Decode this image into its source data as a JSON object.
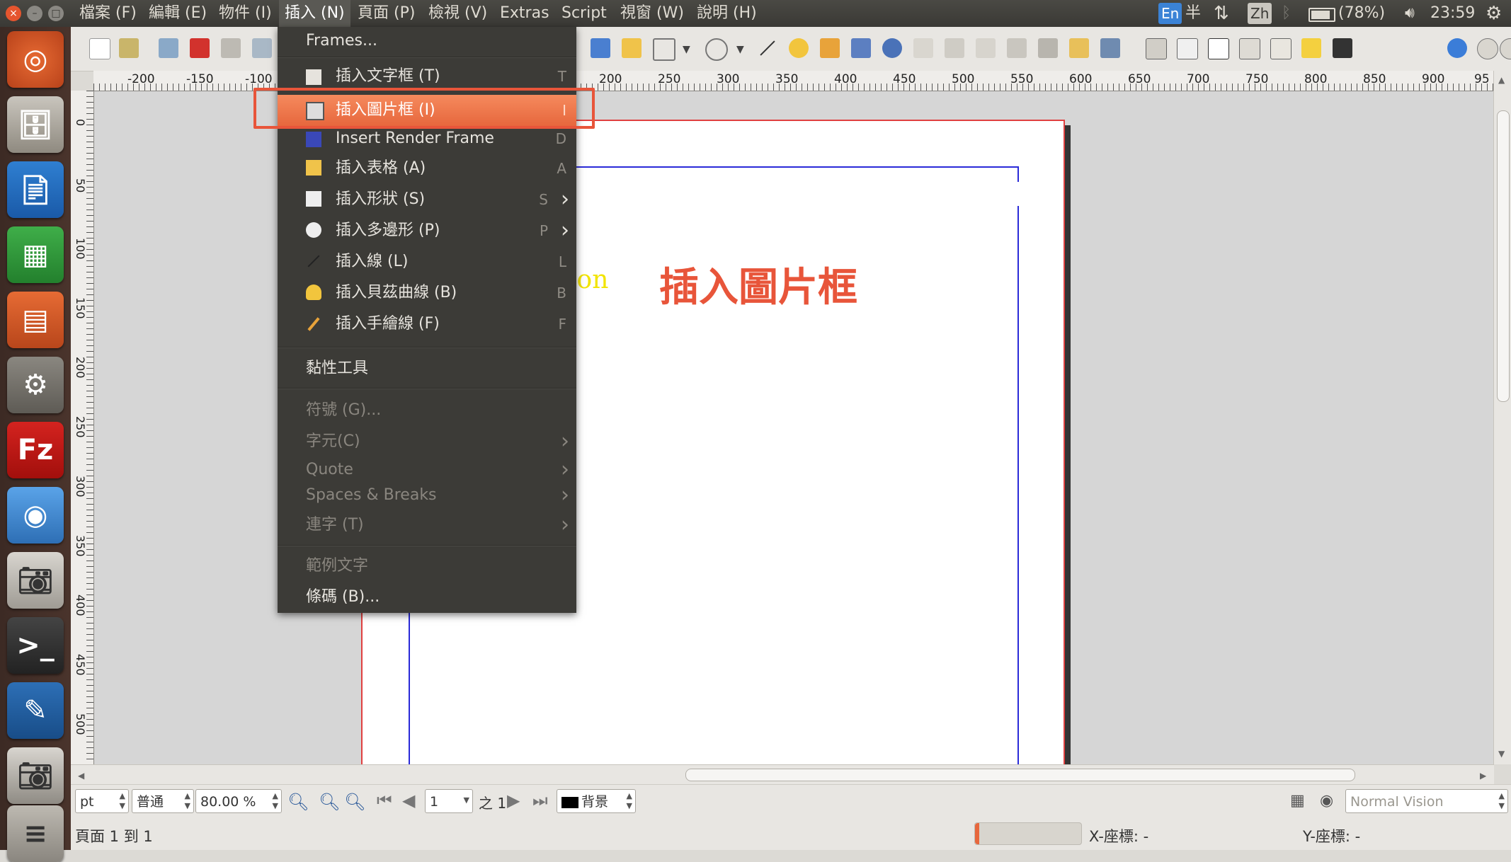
{
  "menubar": {
    "items": [
      "檔案 (F)",
      "編輯 (E)",
      "物件 (I)",
      "插入 (N)",
      "頁面 (P)",
      "檢視 (V)",
      "Extras",
      "Script",
      "視窗 (W)",
      "說明 (H)"
    ],
    "active_index": 3
  },
  "tray": {
    "input_en": "En",
    "half": "半",
    "input_zh": "Zh",
    "battery": "(78%)",
    "time": "23:59"
  },
  "insert_menu": {
    "frames": "Frames...",
    "items": [
      {
        "label": "插入文字框 (T)",
        "shortcut": "T",
        "icon": "text-frame-icon"
      },
      {
        "label": "插入圖片框 (I)",
        "shortcut": "I",
        "icon": "image-frame-icon"
      },
      {
        "label": "Insert Render Frame",
        "shortcut": "D",
        "icon": "render-frame-icon"
      },
      {
        "label": "插入表格 (A)",
        "shortcut": "A",
        "icon": "table-icon"
      },
      {
        "label": "插入形狀 (S)",
        "shortcut": "S",
        "icon": "shape-icon"
      },
      {
        "label": "插入多邊形 (P)",
        "shortcut": "P",
        "icon": "polygon-icon"
      },
      {
        "label": "插入線 (L)",
        "shortcut": "L",
        "icon": "line-icon"
      },
      {
        "label": "插入貝茲曲線 (B)",
        "shortcut": "B",
        "icon": "bezier-icon"
      },
      {
        "label": "插入手繪線 (F)",
        "shortcut": "F",
        "icon": "freehand-icon"
      }
    ],
    "sticky": "黏性工具",
    "symbol": "符號 (G)...",
    "character": "字元(C)",
    "quote": "Quote",
    "spaces": "Spaces & Breaks",
    "ligature": "連字 (T)",
    "sample_text": "範例文字",
    "barcode": "條碼 (B)..."
  },
  "annotation": "插入圖片框",
  "canvas_text": "ion",
  "ruler": {
    "labels": [
      "-200",
      "-150",
      "-100",
      "200",
      "250",
      "300",
      "350",
      "400",
      "450",
      "500",
      "550",
      "600",
      "650",
      "700",
      "750",
      "800",
      "850",
      "900",
      "95"
    ],
    "vlabels": [
      "0",
      "50",
      "100",
      "150",
      "200",
      "250",
      "300",
      "350",
      "400",
      "450",
      "500"
    ]
  },
  "bottombar": {
    "unit": "pt",
    "mode": "普通",
    "zoom": "80.00 %",
    "page": "1",
    "page_of": "之 1",
    "layer": "背景",
    "vision": "Normal Vision"
  },
  "status": {
    "pages": "頁面 1 到 1",
    "x_label": "X-座標: -",
    "y_label": "Y-座標: -"
  },
  "colors": {
    "highlight": "#e7673d",
    "annotation": "#e8553a"
  }
}
